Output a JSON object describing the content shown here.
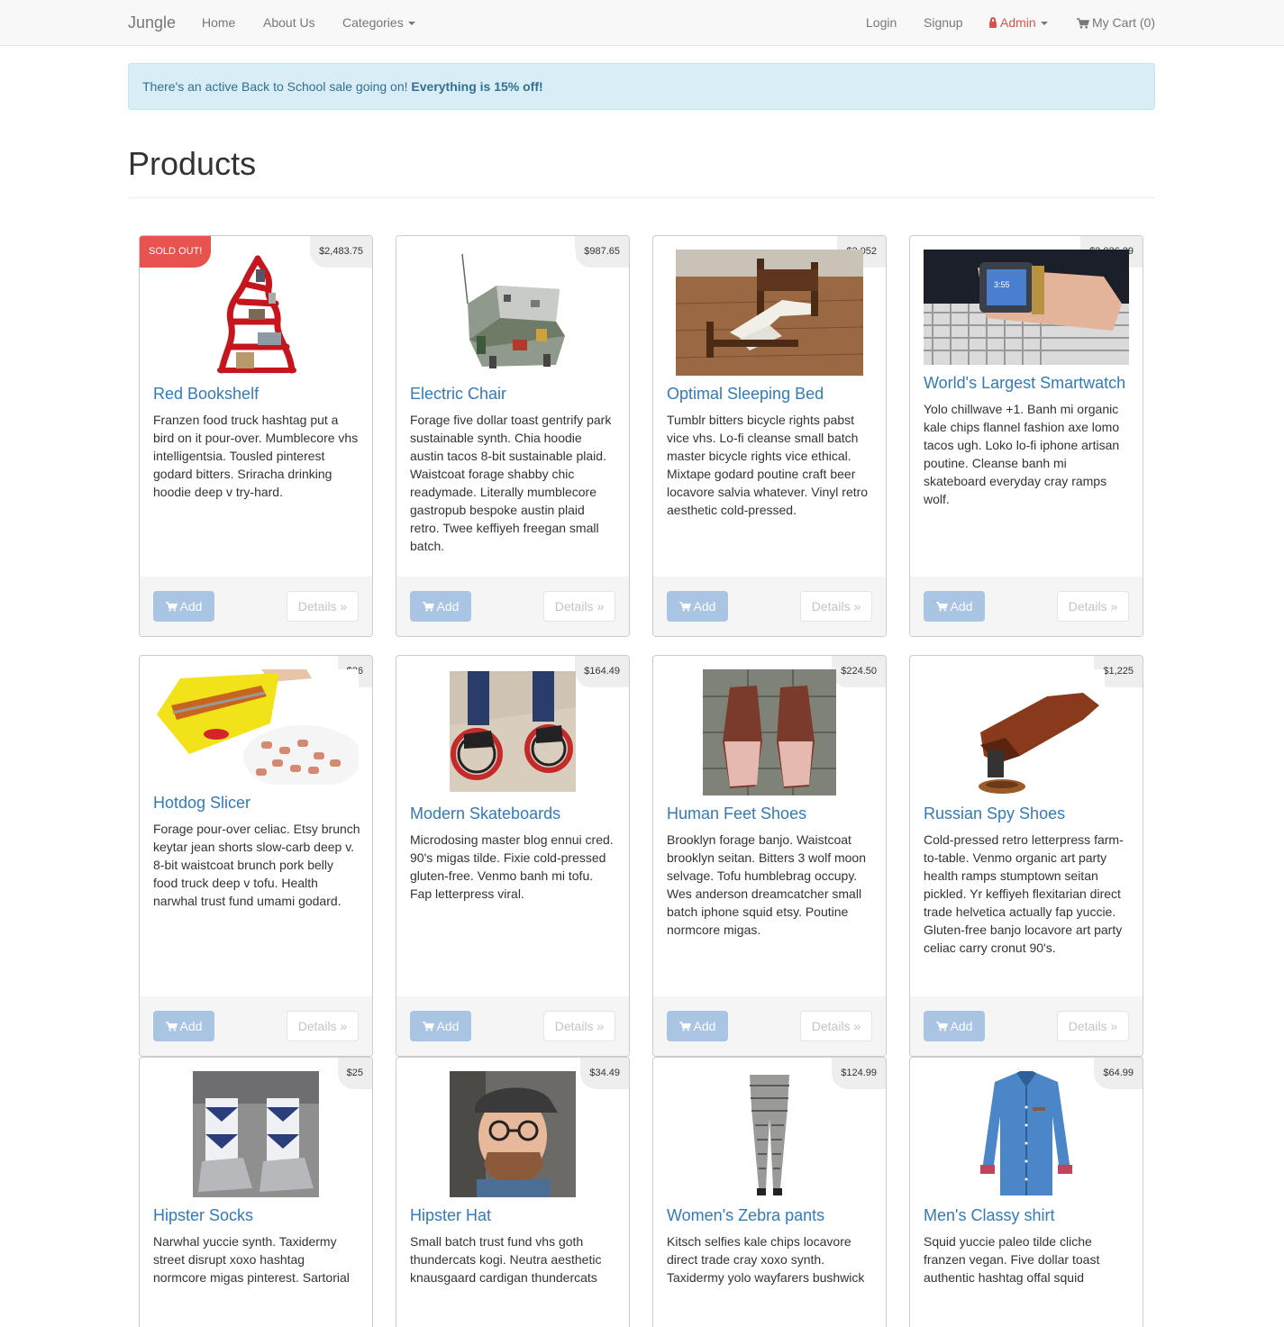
{
  "navbar": {
    "brand": "Jungle",
    "home": "Home",
    "about": "About Us",
    "categories": "Categories",
    "login": "Login",
    "signup": "Signup",
    "admin": "Admin",
    "cart": "My Cart (0)"
  },
  "alert": {
    "text": "There's an active Back to School sale going on!",
    "emphasis": "Everything is 15% off!"
  },
  "page_title": "Products",
  "buttons": {
    "add": "Add",
    "details": "Details »"
  },
  "sold_out_label": "SOLD OUT!",
  "products": [
    {
      "name": "Red Bookshelf",
      "price": "$2,483.75",
      "description": "Franzen food truck hashtag put a bird on it pour-over. Mumblecore vhs intelligentsia. Tousled pinterest godard bitters. Sriracha drinking hoodie deep v try-hard."
    },
    {
      "name": "Electric Chair",
      "price": "$987.65",
      "description": "Forage five dollar toast gentrify park sustainable synth. Chia hoodie austin tacos 8-bit sustainable plaid. Waistcoat forage shabby chic readymade. Literally mumblecore gastropub bespoke austin plaid retro. Twee keffiyeh freegan small batch."
    },
    {
      "name": "Optimal Sleeping Bed",
      "price": "$3,052",
      "description": "Tumblr bitters bicycle rights pabst vice vhs. Lo-fi cleanse small batch master bicycle rights vice ethical. Mixtape godard poutine craft beer locavore salvia whatever. Vinyl retro aesthetic cold-pressed."
    },
    {
      "name": "World's Largest Smartwatch",
      "price": "$2,026.29",
      "description": "Yolo chillwave +1. Banh mi organic kale chips flannel fashion axe lomo tacos ugh. Loko lo-fi iphone artisan poutine. Cleanse banh mi skateboard everyday cray ramps wolf."
    },
    {
      "name": "Hotdog Slicer",
      "price": "$26",
      "description": "Forage pour-over celiac. Etsy brunch keytar jean shorts slow-carb deep v. 8-bit waistcoat brunch pork belly food truck deep v tofu. Health narwhal trust fund umami godard."
    },
    {
      "name": "Modern Skateboards",
      "price": "$164.49",
      "description": "Microdosing master blog ennui cred. 90's migas tilde. Fixie cold-pressed gluten-free. Venmo banh mi tofu. Fap letterpress viral."
    },
    {
      "name": "Human Feet Shoes",
      "price": "$224.50",
      "description": "Brooklyn forage banjo. Waistcoat brooklyn seitan. Bitters 3 wolf moon selvage. Tofu humblebrag occupy. Wes anderson dreamcatcher small batch iphone squid etsy. Poutine normcore migas."
    },
    {
      "name": "Russian Spy Shoes",
      "price": "$1,225",
      "description": "Cold-pressed retro letterpress farm-to-table. Venmo organic art party health ramps stumptown seitan pickled. Yr keffiyeh flexitarian direct trade helvetica actually fap yuccie. Gluten-free banjo locavore art party celiac carry cronut 90's."
    },
    {
      "name": "Hipster Socks",
      "price": "$25",
      "description": "Narwhal yuccie synth. Taxidermy street disrupt xoxo hashtag normcore migas pinterest. Sartorial"
    },
    {
      "name": "Hipster Hat",
      "price": "$34.49",
      "description": "Small batch trust fund vhs goth thundercats kogi. Neutra aesthetic knausgaard cardigan thundercats"
    },
    {
      "name": "Women's Zebra pants",
      "price": "$124.99",
      "description": "Kitsch selfies kale chips locavore direct trade cray xoxo synth. Taxidermy yolo wayfarers bushwick"
    },
    {
      "name": "Men's Classy shirt",
      "price": "$64.99",
      "description": "Squid yuccie paleo tilde cliche franzen vegan. Five dollar toast authentic hashtag offal squid"
    }
  ]
}
